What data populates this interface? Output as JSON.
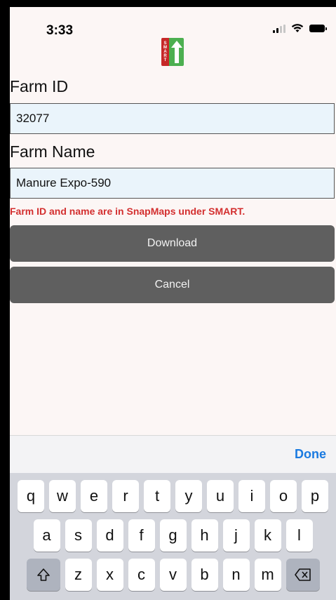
{
  "status_bar": {
    "time": "3:33",
    "icons": [
      "cellular-signal-icon",
      "wifi-icon",
      "battery-icon"
    ]
  },
  "logo": {
    "letters": [
      "S",
      "M",
      "A",
      "R",
      "T"
    ],
    "colors": {
      "left": "#c62828",
      "right": "#4caf50"
    }
  },
  "form": {
    "farm_id_label": "Farm ID",
    "farm_id_value": "32077",
    "farm_name_label": "Farm Name",
    "farm_name_value": "Manure Expo-590",
    "hint": "Farm ID and name are in SnapMaps under SMART."
  },
  "buttons": {
    "download": "Download",
    "cancel": "Cancel"
  },
  "keyboard": {
    "done_label": "Done",
    "row1": [
      "q",
      "w",
      "e",
      "r",
      "t",
      "y",
      "u",
      "i",
      "o",
      "p"
    ],
    "row2": [
      "a",
      "s",
      "d",
      "f",
      "g",
      "h",
      "j",
      "k",
      "l"
    ],
    "row3": [
      "z",
      "x",
      "c",
      "v",
      "b",
      "n",
      "m"
    ],
    "shift_icon": "shift-icon",
    "backspace_icon": "backspace-icon"
  },
  "colors": {
    "background": "#fcf6f5",
    "input_bg": "#eaf4fb",
    "button_bg": "#5f5f5f",
    "hint_text": "#d32f2f",
    "done_text": "#1a7ae0"
  }
}
